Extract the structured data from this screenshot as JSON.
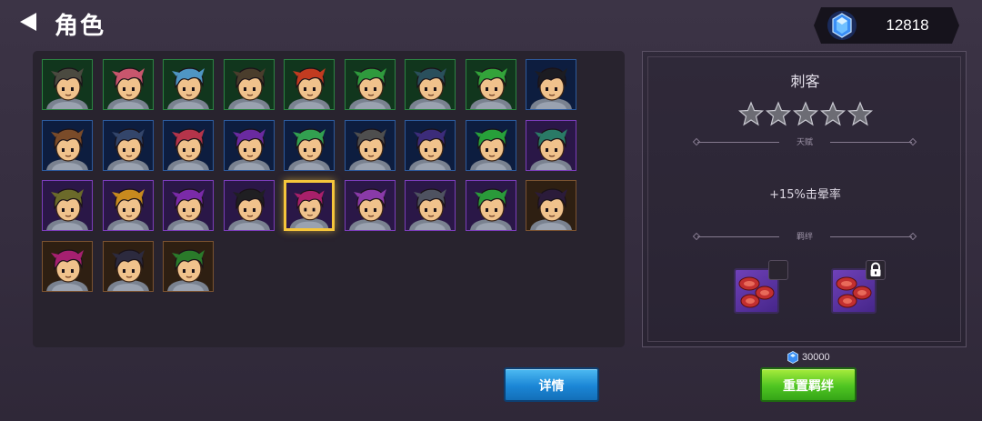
{
  "header": {
    "title": "角色",
    "currency": {
      "icon": "gem-icon",
      "amount": "12818",
      "color": "#3aa0ff"
    }
  },
  "roster": {
    "rows": [
      [
        {
          "rarity": "green",
          "hair": "#4b4a40"
        },
        {
          "rarity": "green",
          "hair": "#c8566d"
        },
        {
          "rarity": "green",
          "hair": "#4f95c4"
        },
        {
          "rarity": "green",
          "hair": "#4a3d2c"
        },
        {
          "rarity": "green",
          "hair": "#c23b20"
        },
        {
          "rarity": "green",
          "hair": "#2f9a3d"
        },
        {
          "rarity": "green",
          "hair": "#2a4f5c"
        },
        {
          "rarity": "green",
          "hair": "#33a33a"
        },
        {
          "rarity": "blue",
          "hair": "#1c1c22"
        }
      ],
      [
        {
          "rarity": "blue",
          "hair": "#7a4b29"
        },
        {
          "rarity": "blue",
          "hair": "#33456a"
        },
        {
          "rarity": "blue",
          "hair": "#b5344a"
        },
        {
          "rarity": "blue",
          "hair": "#6a2aa0"
        },
        {
          "rarity": "blue",
          "hair": "#32a050"
        },
        {
          "rarity": "blue",
          "hair": "#4e4e4e"
        },
        {
          "rarity": "blue",
          "hair": "#3c2c7a"
        },
        {
          "rarity": "blue",
          "hair": "#27a03a"
        },
        {
          "rarity": "purple",
          "hair": "#2a7a66"
        }
      ],
      [
        {
          "rarity": "purple",
          "hair": "#6b6a2a"
        },
        {
          "rarity": "purple",
          "hair": "#c88a1e"
        },
        {
          "rarity": "purple",
          "hair": "#7a2aa8"
        },
        {
          "rarity": "purple",
          "hair": "#1f1f22"
        },
        {
          "rarity": "purple",
          "hair": "#a8206a"
        },
        {
          "rarity": "purple",
          "hair": "#8a3aa8"
        },
        {
          "rarity": "purple",
          "hair": "#4e5260"
        },
        {
          "rarity": "purple",
          "hair": "#2a9a3a"
        },
        {
          "rarity": "brown",
          "hair": "#2b1b3a"
        }
      ],
      [
        {
          "rarity": "brown",
          "hair": "#a52070"
        },
        {
          "rarity": "brown",
          "hair": "#2c2a3e"
        },
        {
          "rarity": "brown",
          "hair": "#2a7a2a"
        }
      ]
    ],
    "selected": {
      "row": 2,
      "col": 4
    }
  },
  "detail": {
    "name": "刺客",
    "stars": 5,
    "talent_label": "天赋",
    "talent_text": "+15%击晕率",
    "bond_label": "羁绊",
    "bond_slots": [
      {
        "icon": "meat-icon",
        "badge": "empty-slot-icon"
      },
      {
        "icon": "meat-icon",
        "badge": "lock-icon"
      }
    ]
  },
  "buttons": {
    "details": "详情",
    "reset_bond": "重置羁绊",
    "reset_cost": "30000"
  }
}
